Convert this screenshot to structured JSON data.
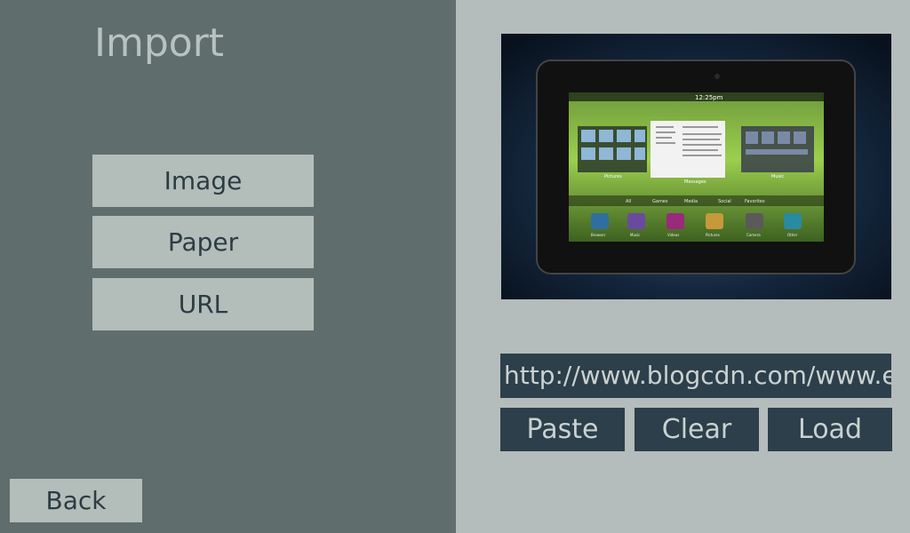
{
  "import": {
    "title": "Import",
    "menu": [
      {
        "label": "Image"
      },
      {
        "label": "Paper"
      },
      {
        "label": "URL"
      }
    ],
    "back_label": "Back"
  },
  "preview": {
    "image_description_icon": "tablet-preview-image",
    "device_status_time": "12:25pm",
    "categories": [
      "All",
      "Games",
      "Media",
      "Social",
      "Favorites"
    ],
    "app_labels": [
      "Browser",
      "Music",
      "Videos",
      "Pictures",
      "Camera",
      "Other"
    ],
    "card_labels": [
      "Pictures",
      "Messages",
      "Music"
    ]
  },
  "url": {
    "value": "http://www.blogcdn.com/www.e"
  },
  "actions": {
    "paste_label": "Paste",
    "clear_label": "Clear",
    "load_label": "Load"
  }
}
